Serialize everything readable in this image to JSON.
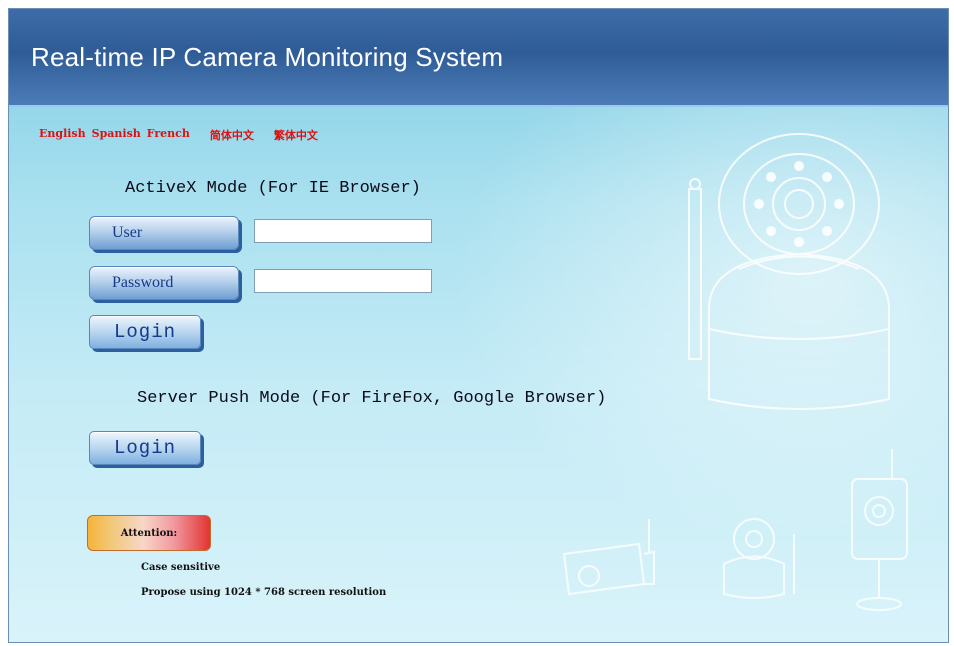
{
  "header": {
    "title": "Real-time IP Camera Monitoring System"
  },
  "languages": [
    "English",
    "Spanish",
    "French",
    "简体中文",
    "繁体中文"
  ],
  "activex": {
    "title": "ActiveX Mode (For IE Browser)",
    "user_label": "User",
    "password_label": "Password",
    "user_value": "",
    "password_value": "",
    "login_label": "Login"
  },
  "server_push": {
    "title": "Server Push Mode (For FireFox, Google Browser)",
    "login_label": "Login"
  },
  "attention": {
    "label": "Attention:",
    "notes": [
      "Case sensitive",
      "Propose using 1024 * 768 screen resolution"
    ]
  }
}
